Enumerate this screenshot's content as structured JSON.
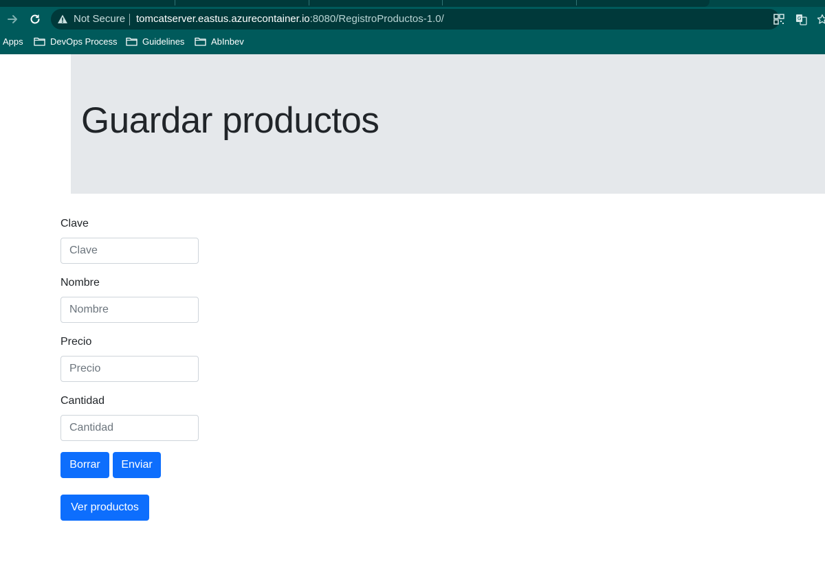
{
  "browser": {
    "security_label": "Not Secure",
    "url_host": "tomcatserver.eastus.azurecontainer.io",
    "url_rest": ":8080/RegistroProductos-1.0/",
    "bookmarks": [
      {
        "label": "Apps"
      },
      {
        "label": "DevOps Process"
      },
      {
        "label": "Guidelines"
      },
      {
        "label": "AbInbev"
      }
    ]
  },
  "page": {
    "title": "Guardar productos",
    "fields": [
      {
        "label": "Clave",
        "placeholder": "Clave",
        "value": ""
      },
      {
        "label": "Nombre",
        "placeholder": "Nombre",
        "value": ""
      },
      {
        "label": "Precio",
        "placeholder": "Precio",
        "value": ""
      },
      {
        "label": "Cantidad",
        "placeholder": "Cantidad",
        "value": ""
      }
    ],
    "buttons": {
      "clear": "Borrar",
      "submit": "Enviar",
      "view": "Ver productos"
    }
  },
  "colors": {
    "chrome_bg": "#005a5b",
    "jumbotron_bg": "#e5e8eb",
    "primary": "#0d6efd"
  }
}
